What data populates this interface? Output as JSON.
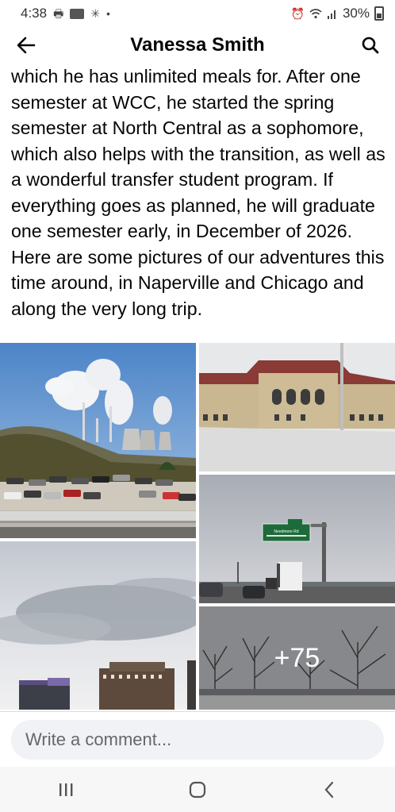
{
  "status_bar": {
    "time": "4:38",
    "battery": "30%",
    "left_icons": [
      "printer-icon",
      "app-badge-icon",
      "pinwheel-icon",
      "dot-icon"
    ],
    "right_icons": [
      "alarm-icon",
      "wifi-icon",
      "signal-icon",
      "battery-icon"
    ]
  },
  "header": {
    "title": "Vanessa Smith",
    "back_icon": "arrow-left-icon",
    "search_icon": "search-icon"
  },
  "post": {
    "text": "which he has unlimited meals for. After one semester at WCC, he started the spring semester at North Central as a sophomore, which also helps with the transition, as well as a wonderful transfer student program. If everything goes as planned, he will graduate one semester early, in December of 2026. Here are some pictures of our adventures this time around, in Naperville and Chicago and along the very long trip."
  },
  "photos": {
    "highway_sign_text": "Needmore Rd",
    "more_count": "+75"
  },
  "comment": {
    "placeholder": "Write a comment..."
  },
  "navbar": {
    "icons": [
      "recent-apps-icon",
      "home-icon",
      "back-nav-icon"
    ]
  }
}
